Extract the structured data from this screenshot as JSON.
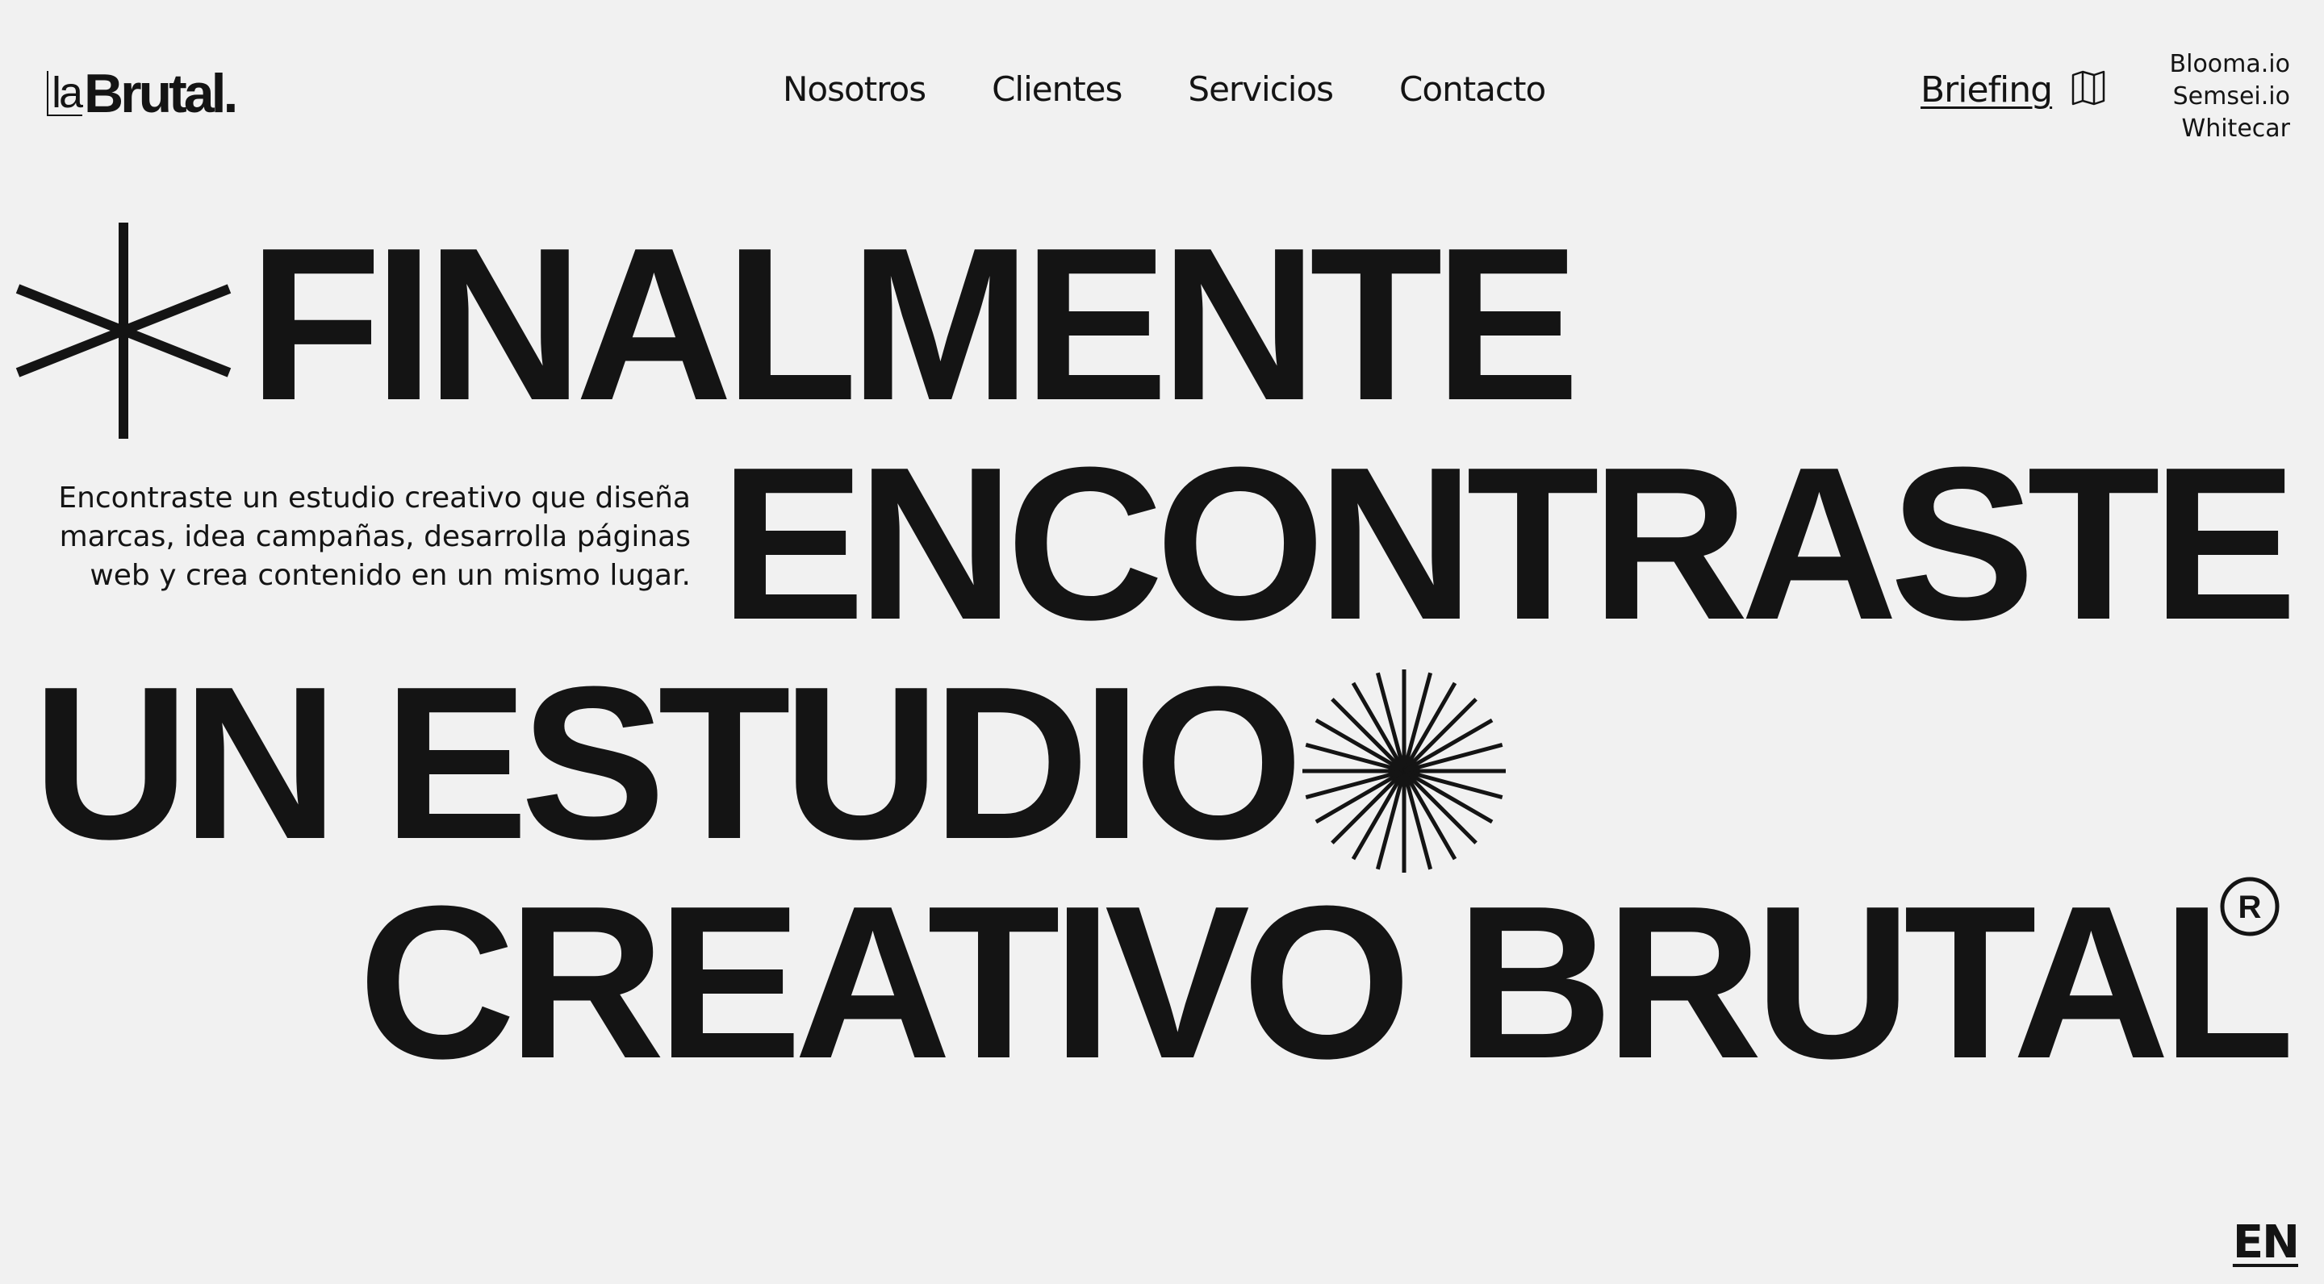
{
  "brand": {
    "prefix": "la",
    "name": "Brutal."
  },
  "nav": [
    "Nosotros",
    "Clientes",
    "Servicios",
    "Contacto"
  ],
  "briefing": {
    "label": "Briefing",
    "icon": "book-icon"
  },
  "sites": [
    "Blooma.io",
    "Semsei.io",
    "Whitecar"
  ],
  "hero": {
    "line1": "FINALMENTE",
    "line2": "ENCONTRASTE",
    "line3": "UN ESTUDIO",
    "line4": "CREATIVO BRUTAL",
    "description": "Encontraste un estudio creativo que diseña marcas, idea campañas, desarrolla páginas web y crea contenido en un mismo lugar."
  },
  "language": "EN",
  "icons": [
    "asterisk-icon",
    "starburst-icon",
    "registered-icon",
    "book-icon"
  ],
  "colors": {
    "background": "#f1f1f1",
    "text": "#141414"
  }
}
